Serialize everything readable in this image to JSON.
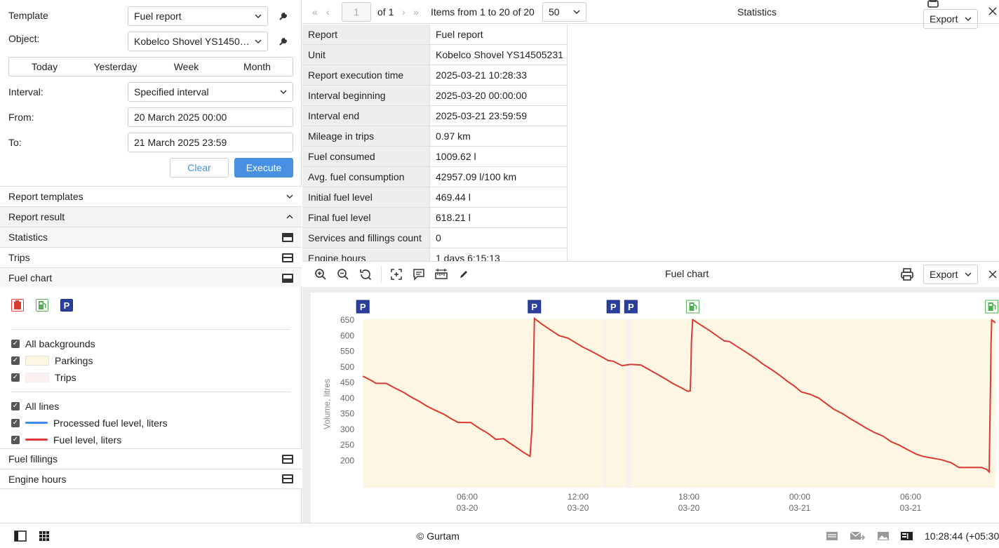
{
  "form": {
    "template_label": "Template",
    "template_value": "Fuel report",
    "object_label": "Object:",
    "object_value": "Kobelco Shovel YS1450…",
    "periods": [
      "Today",
      "Yesterday",
      "Week",
      "Month"
    ],
    "interval_label": "Interval:",
    "interval_value": "Specified interval",
    "from_label": "From:",
    "from_value": "20 March 2025 00:00",
    "to_label": "To:",
    "to_value": "21 March 2025 23:59",
    "clear_label": "Clear",
    "execute_label": "Execute"
  },
  "sections": {
    "report_templates": "Report templates",
    "report_result": "Report result",
    "statistics": "Statistics",
    "trips": "Trips",
    "fuel_chart": "Fuel chart",
    "fuel_fillings": "Fuel fillings",
    "engine_hours": "Engine hours"
  },
  "legend": {
    "all_backgrounds": "All backgrounds",
    "parkings": "Parkings",
    "trips": "Trips",
    "all_lines": "All lines",
    "processed": "Processed fuel level, liters",
    "fuel_level": "Fuel level, liters",
    "colors": {
      "processed": "#3a8ee6",
      "fuel_level": "#d93a33",
      "parking_bg": "#fdf6e3",
      "trip_bg": "#fbeff0"
    }
  },
  "pager": {
    "page": "1",
    "of": "of 1",
    "items": "Items from 1 to 20 of 20",
    "per_page": "50",
    "title": "Statistics",
    "export": "Export"
  },
  "stats": [
    {
      "k": "Report",
      "v": "Fuel report"
    },
    {
      "k": "Unit",
      "v": "Kobelco Shovel YS14505231"
    },
    {
      "k": "Report execution time",
      "v": "2025-03-21 10:28:33"
    },
    {
      "k": "Interval beginning",
      "v": "2025-03-20 00:00:00"
    },
    {
      "k": "Interval end",
      "v": "2025-03-21 23:59:59"
    },
    {
      "k": "Mileage in trips",
      "v": "0.97 km"
    },
    {
      "k": "Fuel consumed",
      "v": "1009.62 l"
    },
    {
      "k": "Avg. fuel consumption",
      "v": "42957.09 l/100 km"
    },
    {
      "k": "Initial fuel level",
      "v": "469.44 l"
    },
    {
      "k": "Final fuel level",
      "v": "618.21 l"
    },
    {
      "k": "Services and fillings count",
      "v": "0"
    },
    {
      "k": "Engine hours",
      "v": "1 days 6:15:13"
    }
  ],
  "chart_panel": {
    "title": "Fuel chart",
    "export": "Export"
  },
  "chart_data": {
    "type": "line",
    "ylabel": "Volume, litres",
    "ylim": [
      180,
      660
    ],
    "yticks": [
      200,
      250,
      300,
      350,
      400,
      450,
      500,
      550,
      600,
      650
    ],
    "x_ticks": [
      {
        "time": "06:00",
        "date": "03-20",
        "h": 6
      },
      {
        "time": "12:00",
        "date": "03-20",
        "h": 12
      },
      {
        "time": "18:00",
        "date": "03-20",
        "h": 18
      },
      {
        "time": "00:00",
        "date": "03-21",
        "h": 24
      },
      {
        "time": "06:00",
        "date": "03-21",
        "h": 30
      }
    ],
    "xlim_hours": [
      0.35,
      34.8
    ],
    "series": [
      {
        "name": "Fuel level, liters",
        "color": "#d93a33",
        "points": [
          [
            0.35,
            470
          ],
          [
            1.0,
            457
          ],
          [
            1.4,
            447
          ],
          [
            2.2,
            447
          ],
          [
            2.9,
            432
          ],
          [
            3.6,
            418
          ],
          [
            4.2,
            403
          ],
          [
            4.8,
            390
          ],
          [
            5.4,
            375
          ],
          [
            6.1,
            361
          ],
          [
            6.8,
            348
          ],
          [
            7.3,
            335
          ],
          [
            7.9,
            322
          ],
          [
            8.9,
            322
          ],
          [
            9.6,
            303
          ],
          [
            10.2,
            289
          ],
          [
            10.9,
            268
          ],
          [
            11.5,
            270
          ],
          [
            12.0,
            256
          ],
          [
            12.6,
            240
          ],
          [
            13.1,
            226
          ],
          [
            13.6,
            214
          ],
          [
            13.75,
            300
          ],
          [
            13.87,
            480
          ],
          [
            13.95,
            655
          ],
          [
            14.6,
            635
          ],
          [
            15.3,
            616
          ],
          [
            15.9,
            600
          ],
          [
            16.6,
            592
          ],
          [
            17.1,
            580
          ],
          [
            17.8,
            563
          ],
          [
            18.5,
            549
          ],
          [
            19.2,
            534
          ],
          [
            19.8,
            520
          ],
          [
            20.2,
            518
          ],
          [
            20.9,
            504
          ],
          [
            21.6,
            508
          ],
          [
            22.4,
            506
          ],
          [
            23.0,
            492
          ],
          [
            23.7,
            476
          ],
          [
            24.4,
            460
          ],
          [
            24.9,
            447
          ],
          [
            25.6,
            433
          ],
          [
            26.1,
            422
          ],
          [
            26.3,
            423
          ],
          [
            26.35,
            477
          ],
          [
            26.4,
            580
          ],
          [
            26.5,
            651
          ],
          [
            27.1,
            635
          ],
          [
            27.8,
            617
          ],
          [
            28.4,
            600
          ],
          [
            29.0,
            583
          ],
          [
            29.4,
            581
          ],
          [
            30.1,
            563
          ],
          [
            30.8,
            545
          ],
          [
            31.5,
            526
          ],
          [
            32.1,
            508
          ],
          [
            32.8,
            490
          ],
          [
            33.4,
            473
          ],
          [
            34.0,
            454
          ],
          [
            34.6,
            437
          ],
          [
            35.1,
            420
          ],
          [
            35.8,
            412
          ],
          [
            36.5,
            400
          ],
          [
            37.1,
            382
          ],
          [
            37.7,
            364
          ],
          [
            38.4,
            350
          ],
          [
            39.0,
            334
          ],
          [
            39.6,
            320
          ],
          [
            40.3,
            303
          ],
          [
            40.9,
            290
          ],
          [
            41.6,
            278
          ],
          [
            42.2,
            261
          ],
          [
            42.9,
            249
          ],
          [
            43.5,
            236
          ],
          [
            44.2,
            221
          ],
          [
            44.8,
            213
          ],
          [
            45.5,
            208
          ],
          [
            46.2,
            203
          ],
          [
            47.0,
            193
          ],
          [
            47.6,
            178
          ],
          [
            48.3,
            178
          ],
          [
            49.4,
            178
          ],
          [
            49.8,
            172
          ],
          [
            50.0,
            164
          ],
          [
            50.1,
            430
          ],
          [
            50.15,
            580
          ],
          [
            50.2,
            650
          ],
          [
            50.8,
            633
          ]
        ]
      }
    ],
    "parkings": [
      [
        0.35,
        13.4
      ],
      [
        13.5,
        14.6
      ],
      [
        14.9,
        50.9
      ]
    ],
    "markers": [
      {
        "type": "parking",
        "h": 0.35,
        "label": "P"
      },
      {
        "type": "parking",
        "h": 13.95,
        "label": "P"
      },
      {
        "type": "parking",
        "h": 20.2,
        "label": "P"
      },
      {
        "type": "parking",
        "h": 21.6,
        "label": "P"
      },
      {
        "type": "filling",
        "h": 26.5
      },
      {
        "type": "filling",
        "h": 50.2
      }
    ]
  },
  "status": {
    "copyright": "© Gurtam",
    "time": "10:28:44 (+05:30"
  }
}
